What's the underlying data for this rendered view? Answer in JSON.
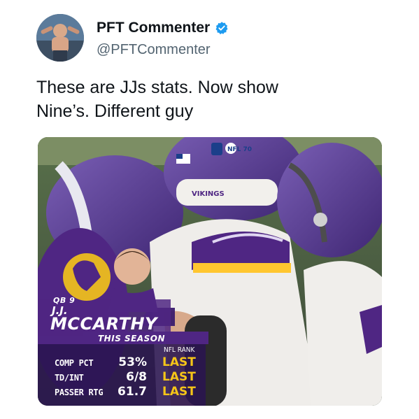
{
  "tweet": {
    "display_name": "PFT Commenter",
    "handle": "@PFTCommenter",
    "text_line1": "These are JJs stats. Now show",
    "text_line2": "Nine’s. Different guy"
  },
  "icons": {
    "verified": "verified-badge-icon",
    "avatar": "avatar-photo"
  },
  "colors": {
    "verified_blue": "#1d9bf0",
    "vikings_purple": "#4f2683",
    "rank_gold": "#f5c518",
    "text_dark": "#0f1419",
    "text_muted": "#536471"
  },
  "graphic": {
    "helmet_logo": "NFL 70",
    "helmet_word": "VIKINGS",
    "position": "QB 9",
    "initials": "J.J.",
    "last_name": "MCCARTHY",
    "season_label": "THIS SEASON",
    "rank_header": "NFL RANK",
    "stats": [
      {
        "label": "COMP PCT",
        "value": "53%",
        "rank": "LAST"
      },
      {
        "label": "TD/INT",
        "value": "6/8",
        "rank": "LAST"
      },
      {
        "label": "PASSER RTG",
        "value": "61.7",
        "rank": "LAST"
      }
    ]
  }
}
